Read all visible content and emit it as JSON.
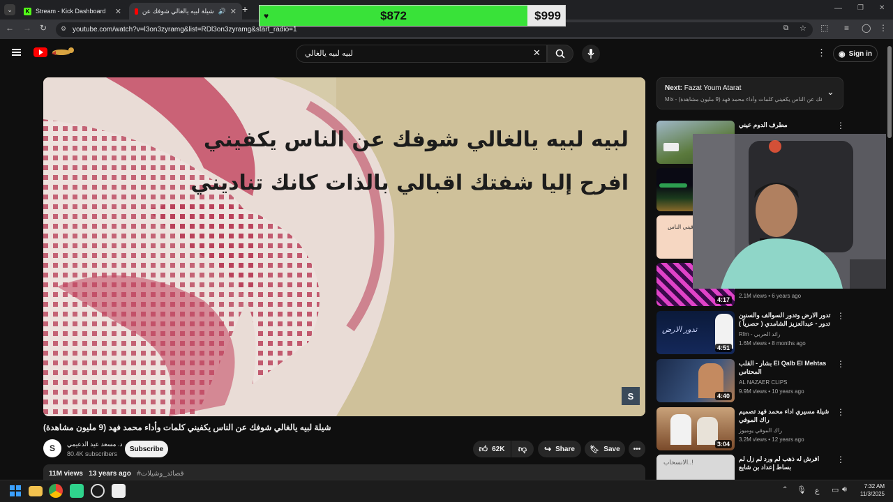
{
  "browser": {
    "tabs": [
      {
        "label": "Stream - Kick Dashboard",
        "icon": "kick-icon"
      },
      {
        "label": "شيلة لبيه يالغالي شوفك عن",
        "icon": "youtube-icon"
      }
    ],
    "url": "youtube.com/watch?v=l3on3zyramg&list=RDl3on3zyramg&start_radio=1"
  },
  "donation": {
    "current": "$872",
    "goal": "$999",
    "progress": 0.873,
    "accent": "#39e239"
  },
  "youtube": {
    "search_value": "لبيه لبيه يالغالي",
    "signin_label": "Sign in"
  },
  "video": {
    "lyrics": [
      "لبيه لبيه يالغالي شوفك عن الناس يكفيني",
      "افرح إليا شفتك اقبالي بالذات كانك تناديني"
    ],
    "watermark": "S",
    "title": "شيلة لبيه يالغالي شوفك عن الناس يكفيني كلمات وأداء محمد فهد (9 مليون مشاهدة)",
    "channel": "د. مسعد عيد الدعيمي",
    "channel_avatar": "S",
    "subscribers": "80.4K subscribers",
    "subscribe_label": "Subscribe",
    "likes": "62K",
    "share_label": "Share",
    "save_label": "Save",
    "views": "11M views",
    "age": "13 years ago",
    "hashtag": "#قصائد_وشيلات"
  },
  "up_next": {
    "prefix": "Next:",
    "title": "Fazat Youm Atarat",
    "subtitle": "Mix - لبيه يالغالي شوفك عن الناس يكفيني كلمات وأداء محمد فهد (9 مليون مشاهدة) ..."
  },
  "recommendations": [
    {
      "title": "مطرف الدوم عيني",
      "channel": "",
      "meta": "",
      "duration": ""
    },
    {
      "title": "",
      "channel": "",
      "meta": "",
      "duration": ""
    },
    {
      "title": "",
      "channel": "",
      "meta": "",
      "duration": "",
      "thumb_text": "ساقيني الناس"
    },
    {
      "title": "",
      "channel": "",
      "meta": "2.1M views • 6 years ago",
      "duration": "4:17"
    },
    {
      "title": "تدور الارض وتدور السوالف والسنين تدور - عبدالعزيز الشامدي ( حصرياً ) 4K",
      "channel": "Rfm - رائد الحربي",
      "meta": "1.6M views • 8 months ago",
      "duration": "4:51",
      "thumb_text": "تدور الارض"
    },
    {
      "title": "El Qalb El Mehtas بشار - القلب المحتاس",
      "channel": "AL NAZAER CLIPS",
      "meta": "9.9M views • 10 years ago",
      "duration": "4:40"
    },
    {
      "title": "شيلة مسيري اداء محمد فهد تصميم راك الموفي",
      "channel": "راك الموفي يوميوز",
      "meta": "3.2M views • 12 years ago",
      "duration": "3:04"
    },
    {
      "title": "افرش له ذهب لم ورد لم زل لم بساط إعداد بن شايع",
      "channel": "شوارع",
      "meta": "",
      "duration": "",
      "thumb_text": "الانسحاب..!"
    }
  ],
  "taskbar": {
    "language": "ع",
    "time": "7:32 AM",
    "date": "11/3/2025"
  }
}
